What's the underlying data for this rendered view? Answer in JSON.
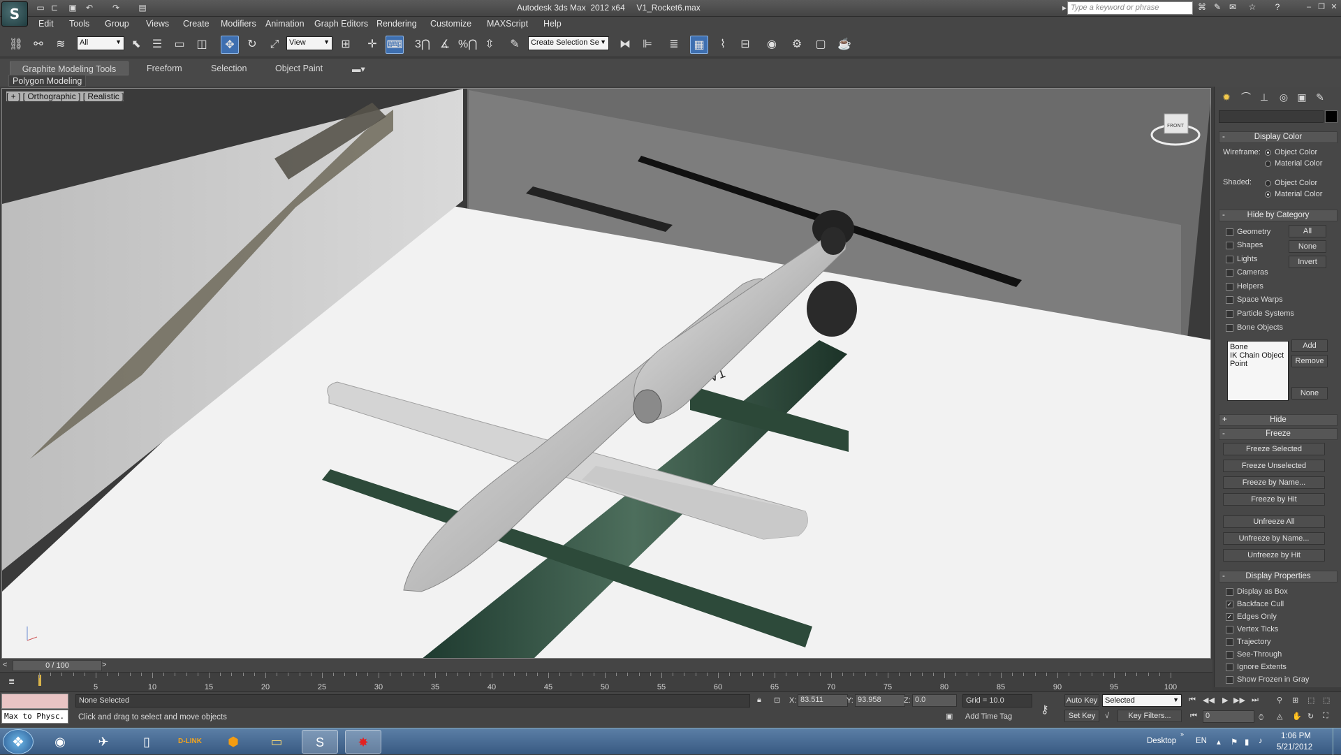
{
  "app": {
    "logo": "S",
    "title": "Autodesk 3ds Max  2012 x64     V1_Rocket6.max",
    "search_placeholder": "Type a keyword or phrase"
  },
  "menu": [
    "Edit",
    "Tools",
    "Group",
    "Views",
    "Create",
    "Modifiers",
    "Animation",
    "Graph Editors",
    "Rendering",
    "Customize",
    "MAXScript",
    "Help"
  ],
  "toolbar": {
    "selection_filter": "All",
    "ref_coord": "View",
    "named_selection": "Create Selection Se",
    "snap_labels": [
      "3",
      "%"
    ]
  },
  "ribbon": {
    "tabs": [
      "Graphite Modeling Tools",
      "Freeform",
      "Selection",
      "Object Paint"
    ],
    "active_tab": "Graphite Modeling Tools",
    "panel": "Polygon Modeling"
  },
  "viewport": {
    "label": "[ + ] [ Orthographic ] [ Realistic ]",
    "viewcube_label": "FRONT",
    "plate_text": "V1"
  },
  "command_panel": {
    "display_color": {
      "title": "Display Color",
      "wireframe_label": "Wireframe:",
      "shaded_label": "Shaded:",
      "object_color": "Object Color",
      "material_color": "Material Color",
      "wireframe_selected": "Object Color",
      "shaded_selected": "Material Color"
    },
    "hide_by_category": {
      "title": "Hide by Category",
      "items": [
        {
          "label": "Geometry",
          "checked": false
        },
        {
          "label": "Shapes",
          "checked": false
        },
        {
          "label": "Lights",
          "checked": false
        },
        {
          "label": "Cameras",
          "checked": false
        },
        {
          "label": "Helpers",
          "checked": false
        },
        {
          "label": "Space Warps",
          "checked": false
        },
        {
          "label": "Particle Systems",
          "checked": false
        },
        {
          "label": "Bone Objects",
          "checked": false
        }
      ],
      "buttons": [
        "All",
        "None",
        "Invert"
      ],
      "list_items": [
        "Bone",
        "IK Chain Object",
        "Point"
      ],
      "add": "Add",
      "remove": "Remove",
      "none": "None"
    },
    "hide": {
      "title": "Hide"
    },
    "freeze": {
      "title": "Freeze",
      "buttons": [
        "Freeze Selected",
        "Freeze Unselected",
        "Freeze by Name...",
        "Freeze by Hit",
        "Unfreeze All",
        "Unfreeze by Name...",
        "Unfreeze by Hit"
      ]
    },
    "display_properties": {
      "title": "Display Properties",
      "items": [
        {
          "label": "Display as Box",
          "checked": false
        },
        {
          "label": "Backface Cull",
          "checked": true
        },
        {
          "label": "Edges Only",
          "checked": true
        },
        {
          "label": "Vertex Ticks",
          "checked": false
        },
        {
          "label": "Trajectory",
          "checked": false
        },
        {
          "label": "See-Through",
          "checked": false
        },
        {
          "label": "Ignore Extents",
          "checked": false
        },
        {
          "label": "Show Frozen in Gray",
          "checked": false
        }
      ]
    }
  },
  "timeline": {
    "slider_text": "0 / 100",
    "ticks": [
      "5",
      "10",
      "15",
      "20",
      "25",
      "30",
      "35",
      "40",
      "45",
      "50",
      "55",
      "60",
      "65",
      "70",
      "75",
      "80",
      "85",
      "90",
      "95",
      "100"
    ]
  },
  "status": {
    "listener": "Max to Physc.",
    "selection": "None Selected",
    "prompt": "Click and drag to select and move objects",
    "x_label": "X:",
    "x": "83.511",
    "y_label": "Y:",
    "y": "93.958",
    "z_label": "Z:",
    "z": "0.0",
    "grid": "Grid = 10.0",
    "add_time_tag": "Add Time Tag",
    "auto_key": "Auto Key",
    "set_key": "Set Key",
    "key_mode": "Selected",
    "key_filters": "Key Filters...",
    "frame": "0"
  },
  "taskbar": {
    "icons": [
      "windows-start",
      "chrome",
      "thunderbird",
      "usb-tool",
      "dlink",
      "sublime",
      "explorer",
      "3dsmax",
      "splat-app"
    ],
    "dlink_label": "D-LINK",
    "desktop": "Desktop",
    "lang": "EN",
    "time": "1:06 PM",
    "date": "5/21/2012"
  }
}
